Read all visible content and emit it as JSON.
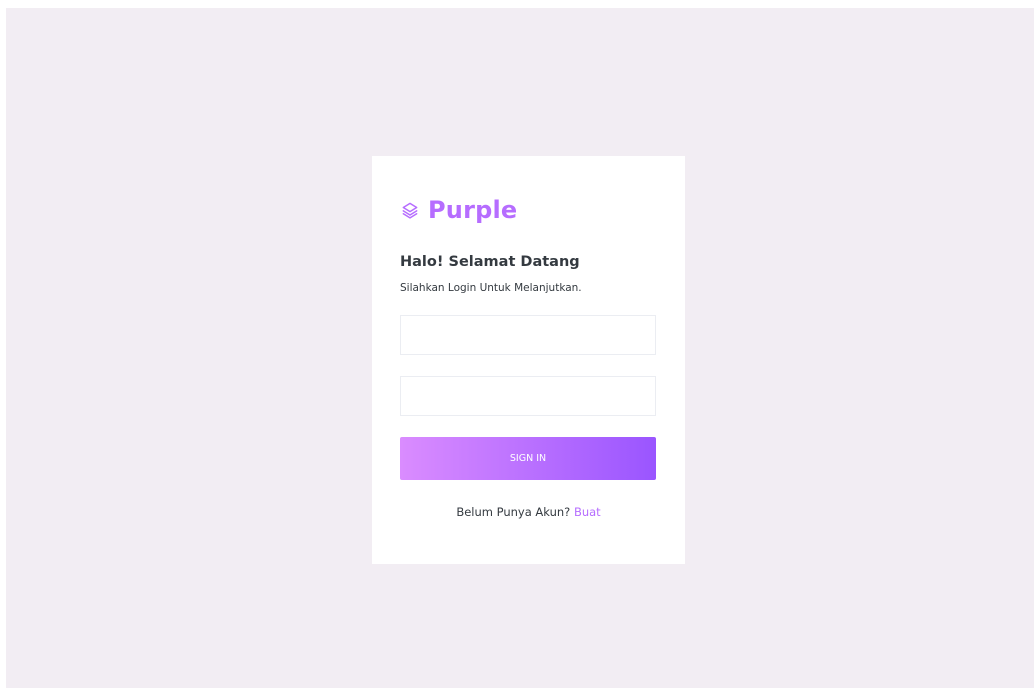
{
  "brand": {
    "icon": "layers-icon",
    "name": "Purple",
    "color": "#b66dff"
  },
  "login": {
    "heading": "Halo! Selamat Datang",
    "subheading": "Silahkan Login Untuk Melanjutkan.",
    "username": {
      "value": "",
      "placeholder": ""
    },
    "password": {
      "value": "",
      "placeholder": ""
    },
    "submit_label": "SIGN IN",
    "register_prompt": "Belum Punya Akun?",
    "register_link": "Buat"
  },
  "colors": {
    "page_background": "#f2edf3",
    "card_background": "#ffffff",
    "button_gradient_start": "#da8cff",
    "button_gradient_end": "#9a55ff",
    "link": "#b66dff"
  }
}
